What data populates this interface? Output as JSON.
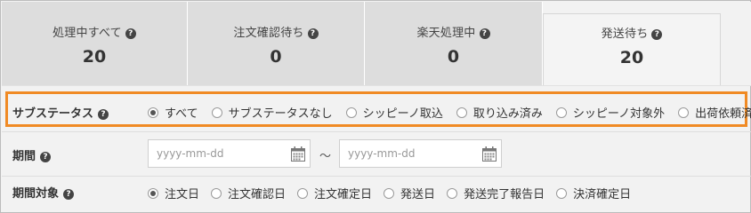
{
  "tabs": [
    {
      "label": "処理中すべて",
      "count": "20"
    },
    {
      "label": "注文確認待ち",
      "count": "0"
    },
    {
      "label": "楽天処理中",
      "count": "0"
    },
    {
      "label": "発送待ち",
      "count": "20",
      "active": true
    }
  ],
  "help_glyph": "?",
  "substatus": {
    "label": "サブステータス",
    "options": [
      "すべて",
      "サブステータスなし",
      "シッピーノ取込",
      "取り込み済み",
      "シッピーノ対象外",
      "出荷依頼済"
    ],
    "selected": 0
  },
  "period": {
    "label": "期間",
    "from_placeholder": "yyyy-mm-dd",
    "to_placeholder": "yyyy-mm-dd",
    "separator": "～"
  },
  "period_target": {
    "label": "期間対象",
    "options": [
      "注文日",
      "注文確認日",
      "注文確定日",
      "発送日",
      "発送完了報告日",
      "決済確定日"
    ],
    "selected": 0
  },
  "colors": {
    "highlight": "#f08a24",
    "active_tab": "#f4f4f4",
    "inactive_tab": "#dddddd"
  },
  "icons": [
    "help-icon",
    "calendar-icon"
  ]
}
